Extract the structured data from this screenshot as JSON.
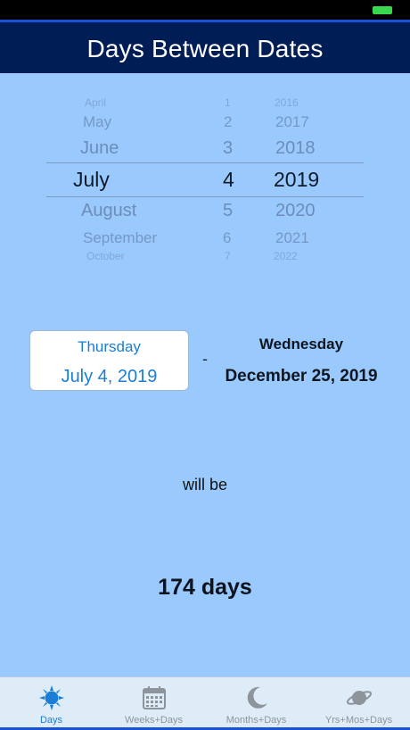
{
  "nav": {
    "title": "Days Between Dates"
  },
  "picker": {
    "months": [
      "April",
      "May",
      "June",
      "July",
      "August",
      "September",
      "October"
    ],
    "days": [
      "1",
      "2",
      "3",
      "4",
      "5",
      "6",
      "7"
    ],
    "years": [
      "2016",
      "2017",
      "2018",
      "2019",
      "2020",
      "2021",
      "2022"
    ],
    "selected_index": 3
  },
  "start": {
    "weekday": "Thursday",
    "date": "July 4, 2019"
  },
  "separator": "-",
  "end": {
    "weekday": "Wednesday",
    "date": "December 25, 2019"
  },
  "connector": "will be",
  "result": "174 days",
  "tabs": [
    {
      "label": "Days",
      "icon": "sun-icon"
    },
    {
      "label": "Weeks+Days",
      "icon": "calendar-icon"
    },
    {
      "label": "Months+Days",
      "icon": "moon-icon"
    },
    {
      "label": "Yrs+Mos+Days",
      "icon": "planet-icon"
    }
  ],
  "colors": {
    "background": "#99c9fd",
    "nav": "#011d56",
    "accent": "#1a7ed6",
    "battery": "#39d84f"
  }
}
